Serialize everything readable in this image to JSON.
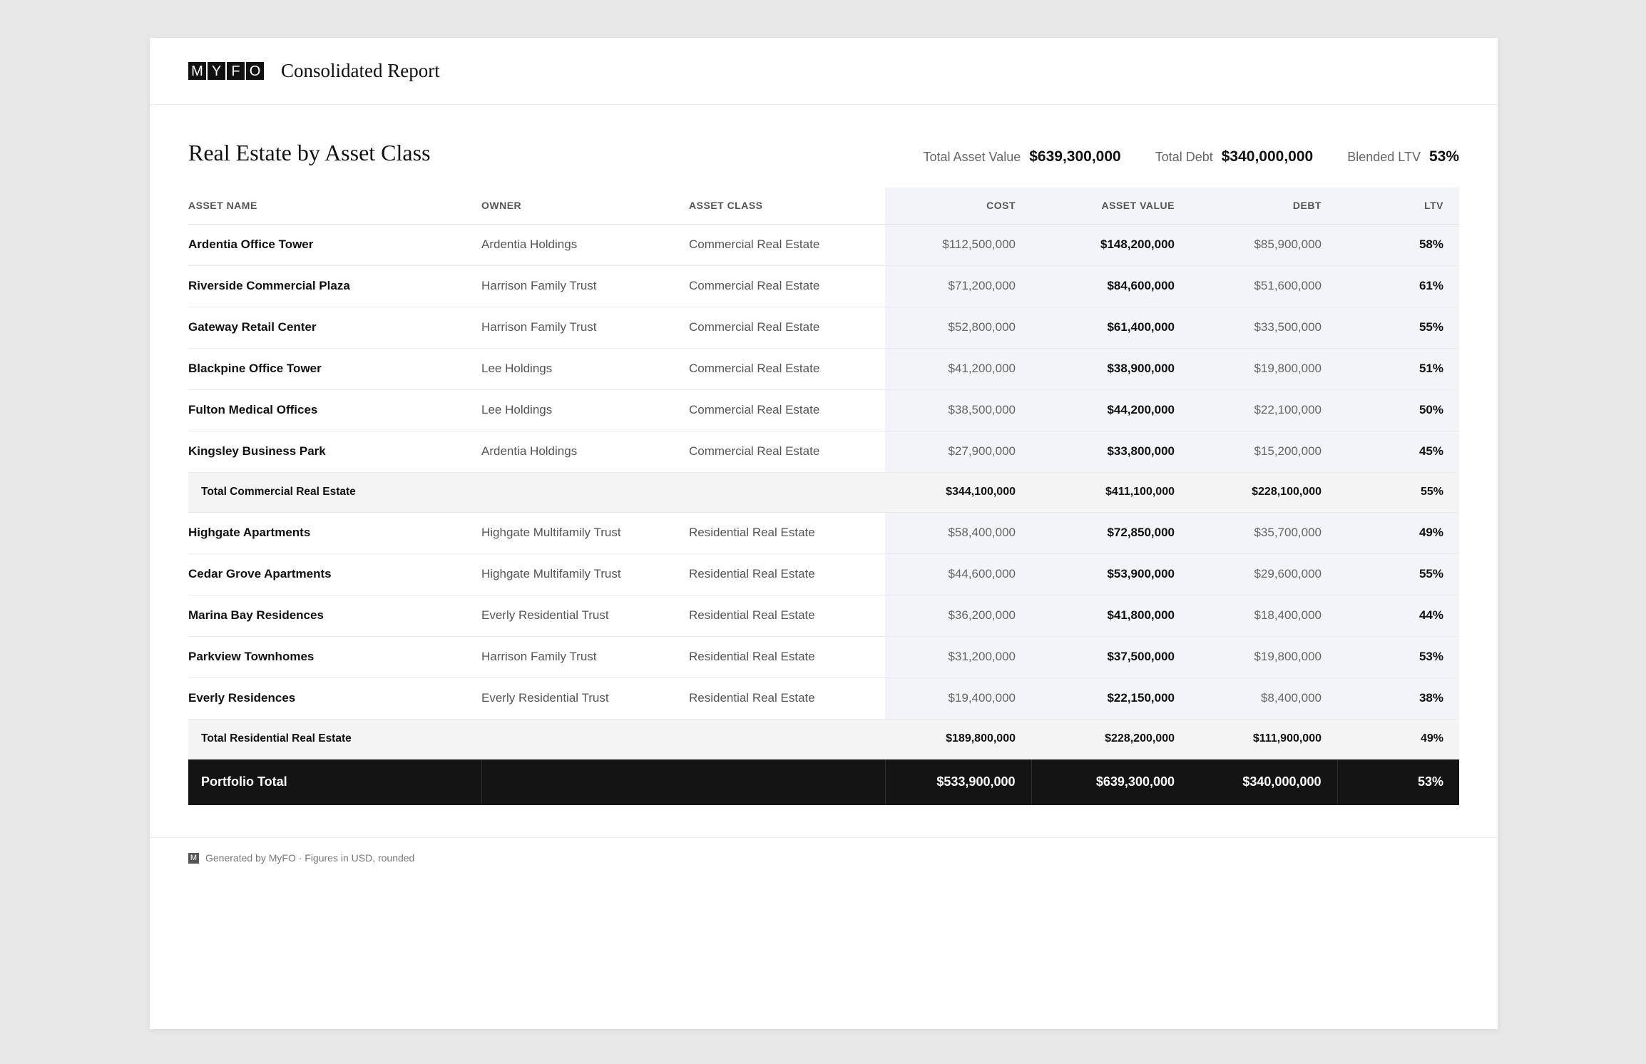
{
  "header": {
    "logo_letters": [
      "M",
      "Y",
      "F",
      "O"
    ],
    "title": "Consolidated Report"
  },
  "section": {
    "title": "Real Estate by Asset Class",
    "summary": [
      {
        "label": "Total Asset Value",
        "value": "$639,300,000"
      },
      {
        "label": "Total Debt",
        "value": "$340,000,000"
      },
      {
        "label": "Blended LTV",
        "value": "53%"
      }
    ]
  },
  "table": {
    "columns": [
      "ASSET NAME",
      "OWNER",
      "ASSET CLASS",
      "COST",
      "ASSET VALUE",
      "DEBT",
      "LTV"
    ],
    "groups": [
      {
        "rows": [
          {
            "name": "Ardentia Office Tower",
            "owner": "Ardentia Holdings",
            "class": "Commercial Real Estate",
            "cost": "$112,500,000",
            "value": "$148,200,000",
            "debt": "$85,900,000",
            "ltv": "58%"
          },
          {
            "name": "Riverside Commercial Plaza",
            "owner": "Harrison Family Trust",
            "class": "Commercial Real Estate",
            "cost": "$71,200,000",
            "value": "$84,600,000",
            "debt": "$51,600,000",
            "ltv": "61%"
          },
          {
            "name": "Gateway Retail Center",
            "owner": "Harrison Family Trust",
            "class": "Commercial Real Estate",
            "cost": "$52,800,000",
            "value": "$61,400,000",
            "debt": "$33,500,000",
            "ltv": "55%"
          },
          {
            "name": "Blackpine Office Tower",
            "owner": "Lee Holdings",
            "class": "Commercial Real Estate",
            "cost": "$41,200,000",
            "value": "$38,900,000",
            "debt": "$19,800,000",
            "ltv": "51%"
          },
          {
            "name": "Fulton Medical Offices",
            "owner": "Lee Holdings",
            "class": "Commercial Real Estate",
            "cost": "$38,500,000",
            "value": "$44,200,000",
            "debt": "$22,100,000",
            "ltv": "50%"
          },
          {
            "name": "Kingsley Business Park",
            "owner": "Ardentia Holdings",
            "class": "Commercial Real Estate",
            "cost": "$27,900,000",
            "value": "$33,800,000",
            "debt": "$15,200,000",
            "ltv": "45%"
          }
        ],
        "total": {
          "label": "Total Commercial Real Estate",
          "cost": "$344,100,000",
          "value": "$411,100,000",
          "debt": "$228,100,000",
          "ltv": "55%"
        }
      },
      {
        "rows": [
          {
            "name": "Highgate Apartments",
            "owner": "Highgate Multifamily Trust",
            "class": "Residential Real Estate",
            "cost": "$58,400,000",
            "value": "$72,850,000",
            "debt": "$35,700,000",
            "ltv": "49%"
          },
          {
            "name": "Cedar Grove Apartments",
            "owner": "Highgate Multifamily Trust",
            "class": "Residential Real Estate",
            "cost": "$44,600,000",
            "value": "$53,900,000",
            "debt": "$29,600,000",
            "ltv": "55%"
          },
          {
            "name": "Marina Bay Residences",
            "owner": "Everly Residential Trust",
            "class": "Residential Real Estate",
            "cost": "$36,200,000",
            "value": "$41,800,000",
            "debt": "$18,400,000",
            "ltv": "44%"
          },
          {
            "name": "Parkview Townhomes",
            "owner": "Harrison Family Trust",
            "class": "Residential Real Estate",
            "cost": "$31,200,000",
            "value": "$37,500,000",
            "debt": "$19,800,000",
            "ltv": "53%"
          },
          {
            "name": "Everly Residences",
            "owner": "Everly Residential Trust",
            "class": "Residential Real Estate",
            "cost": "$19,400,000",
            "value": "$22,150,000",
            "debt": "$8,400,000",
            "ltv": "38%"
          }
        ],
        "total": {
          "label": "Total Residential Real Estate",
          "cost": "$189,800,000",
          "value": "$228,200,000",
          "debt": "$111,900,000",
          "ltv": "49%"
        }
      }
    ],
    "grand_total": {
      "label": "Portfolio Total",
      "cost": "$533,900,000",
      "value": "$639,300,000",
      "debt": "$340,000,000",
      "ltv": "53%"
    }
  },
  "footer": {
    "icon_letter": "M",
    "text": "Generated by MyFO · Figures in USD, rounded"
  },
  "colors": {
    "numeric_column_shade": "#f2f4f8",
    "subtotal_row": "#f4f4f4",
    "grand_total_row": "#141414"
  }
}
